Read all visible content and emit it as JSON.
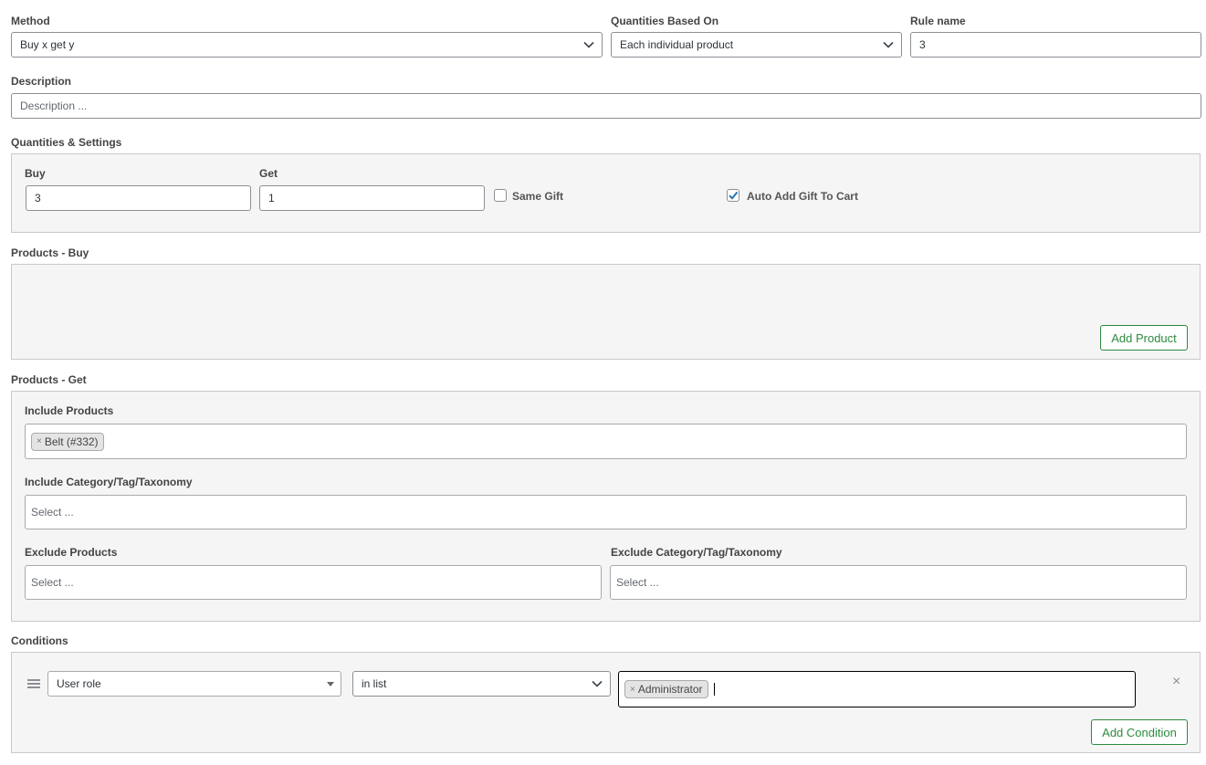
{
  "top": {
    "method_label": "Method",
    "method_value": "Buy x get y",
    "qty_based_label": "Quantities Based On",
    "qty_based_value": "Each individual product",
    "rule_name_label": "Rule name",
    "rule_name_value": "3"
  },
  "description": {
    "label": "Description",
    "placeholder": "Description ..."
  },
  "quantities": {
    "section_label": "Quantities & Settings",
    "buy_label": "Buy",
    "buy_value": "3",
    "get_label": "Get",
    "get_value": "1",
    "same_gift_label": "Same Gift",
    "same_gift_checked": false,
    "auto_add_label": "Auto Add Gift To Cart",
    "auto_add_checked": true
  },
  "products_buy": {
    "section_label": "Products - Buy",
    "add_button": "Add Product"
  },
  "products_get": {
    "section_label": "Products - Get",
    "include_products_label": "Include Products",
    "include_products_chip": "Belt (#332)",
    "include_taxonomy_label": "Include Category/Tag/Taxonomy",
    "include_taxonomy_placeholder": "Select ...",
    "exclude_products_label": "Exclude Products",
    "exclude_products_placeholder": "Select ...",
    "exclude_taxonomy_label": "Exclude Category/Tag/Taxonomy",
    "exclude_taxonomy_placeholder": "Select ..."
  },
  "conditions": {
    "section_label": "Conditions",
    "type_value": "User role",
    "operator_value": "in list",
    "value_chip": "Administrator",
    "add_button": "Add Condition"
  },
  "icons": {
    "chip_remove": "×",
    "remove_condition": "×"
  },
  "colors": {
    "accent_green": "#2d8a3f",
    "panel_bg": "#f5f5f5",
    "checkbox_blue": "#2271b1"
  }
}
